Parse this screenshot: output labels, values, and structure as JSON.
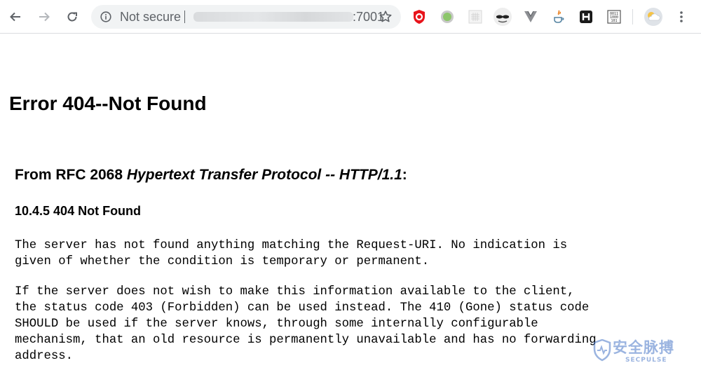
{
  "browser": {
    "omnibox": {
      "security_label": "Not secure",
      "url_tail": ":7001"
    },
    "extensions": [
      "ublock-icon",
      "green-circle-extension-icon",
      "grid-extension-icon",
      "incognito-mask-extension-icon",
      "vue-devtools-icon",
      "java-extension-icon",
      "h-extension-icon",
      "binary-extension-icon",
      "weather-extension-icon"
    ]
  },
  "page": {
    "title": "Error 404--Not Found",
    "rfc_prefix": "From RFC 2068 ",
    "rfc_title": "Hypertext Transfer Protocol -- HTTP/1.1",
    "rfc_suffix": ":",
    "section": "10.4.5 404 Not Found",
    "paragraph1": "The server has not found anything matching the Request-URI. No indication is\ngiven of whether the condition is temporary or permanent.",
    "paragraph2": "If the server does not wish to make this information available to the client,\nthe status code 403 (Forbidden) can be used instead. The 410 (Gone) status code\nSHOULD be used if the server knows, through some internally configurable\nmechanism, that an old resource is permanently unavailable and has no forwarding\naddress."
  },
  "watermark": {
    "text": "安全脉搏",
    "sub": "SECPULSE"
  }
}
